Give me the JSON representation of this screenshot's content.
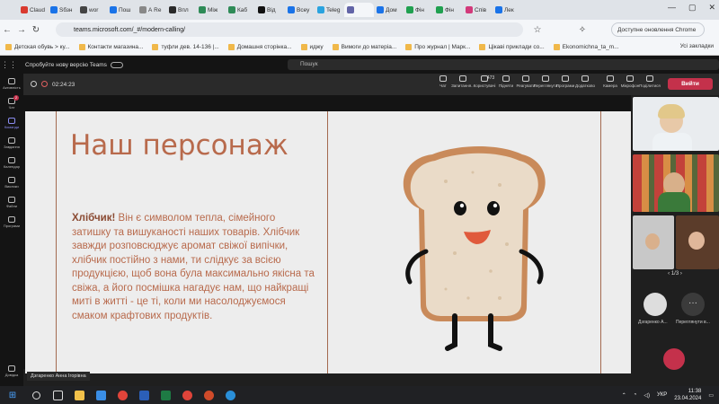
{
  "browser": {
    "tabs": [
      {
        "label": "Claud",
        "color": "#d93a2f"
      },
      {
        "label": "Sбзн",
        "color": "#1a73e8"
      },
      {
        "label": "wor",
        "color": "#444444"
      },
      {
        "label": "Пош",
        "color": "#1a73e8"
      },
      {
        "label": "А Re",
        "color": "#888888"
      },
      {
        "label": "Впл",
        "color": "#2a2a2a"
      },
      {
        "label": "Між",
        "color": "#2e8b57"
      },
      {
        "label": "Каб",
        "color": "#2e8b57"
      },
      {
        "label": "Від",
        "color": "#111111"
      },
      {
        "label": "Всеу",
        "color": "#1a73e8"
      },
      {
        "label": "Teleg",
        "color": "#2aa3df"
      },
      {
        "label": "",
        "color": "#6264a7"
      },
      {
        "label": "Дом",
        "color": "#1a73e8"
      },
      {
        "label": "Фін",
        "color": "#20a050"
      },
      {
        "label": "Фін",
        "color": "#20a050"
      },
      {
        "label": "Спів",
        "color": "#d2397a"
      },
      {
        "label": "Лек",
        "color": "#1a73e8"
      }
    ],
    "url": "teams.microsoft.com/_#/modern-calling/",
    "update_label": "Доступне оновлення Chrome",
    "bookmarks": [
      "Детская обувь > ку...",
      "Контакти магазина...",
      "туфли дев. 14-136 |...",
      "Домашня сторінка...",
      "иджу",
      "Вимоги до матеріа...",
      "Про журнал | Марк...",
      "Цікаві приклади со...",
      "Ekonomichna_ta_m..."
    ],
    "all_bookmarks": "Усі закладки"
  },
  "teams": {
    "try_new": "Спробуйте нову версію Teams",
    "search_placeholder": "Пошук",
    "rail": [
      "Активність",
      "Чат",
      "Команди",
      "Завдання",
      "Календар",
      "Виклики",
      "Файли",
      "Програми",
      "Довідка"
    ],
    "chat_badge": "2",
    "timer": "02:24:23",
    "controls": [
      {
        "label": "Чат",
        "name": "chat"
      },
      {
        "label": "Запитання...",
        "name": "questions"
      },
      {
        "label": "Користувачі",
        "name": "people",
        "count": "473"
      },
      {
        "label": "Підняти",
        "name": "raise-hand"
      },
      {
        "label": "Реагувати",
        "name": "react"
      },
      {
        "label": "Переглянути",
        "name": "view"
      },
      {
        "label": "Програми",
        "name": "apps"
      },
      {
        "label": "Додатково",
        "name": "more"
      },
      {
        "label": "Камера",
        "name": "camera"
      },
      {
        "label": "Мікрофон",
        "name": "mic"
      },
      {
        "label": "Поділитися",
        "name": "share"
      }
    ],
    "leave_label": "Вийти",
    "pager": "1/3",
    "participants": [
      {
        "label": "Дзгаренко А...",
        "name": "participant-dzgarenko"
      },
      {
        "label": "Переглянути в...",
        "name": "view-more"
      }
    ],
    "presenter_name": "Дзгаренко Анна Ігорівна"
  },
  "slide": {
    "title": "Наш персонаж",
    "lead": "Хлібчик!",
    "body": " Він є символом тепла, сімейного затишку та вишуканості наших товарів. Хлібчик завжди розповсюджує аромат свіжої випічки, хлібчик постійно з нами, ти слідкує за всією продукцією, щоб вона була максимально якісна та свіжа, а його посмішка нагадує нам, що найкращі миті в житті - це ті, коли ми насолоджуємося смаком крафтових продуктів."
  },
  "taskbar": {
    "time": "11:38",
    "date": "23.04.2024",
    "lang": "УКР"
  },
  "colors": {
    "slide_text": "#b86a4c",
    "leave": "#c4314b",
    "teams_accent": "#8b8cf0"
  }
}
